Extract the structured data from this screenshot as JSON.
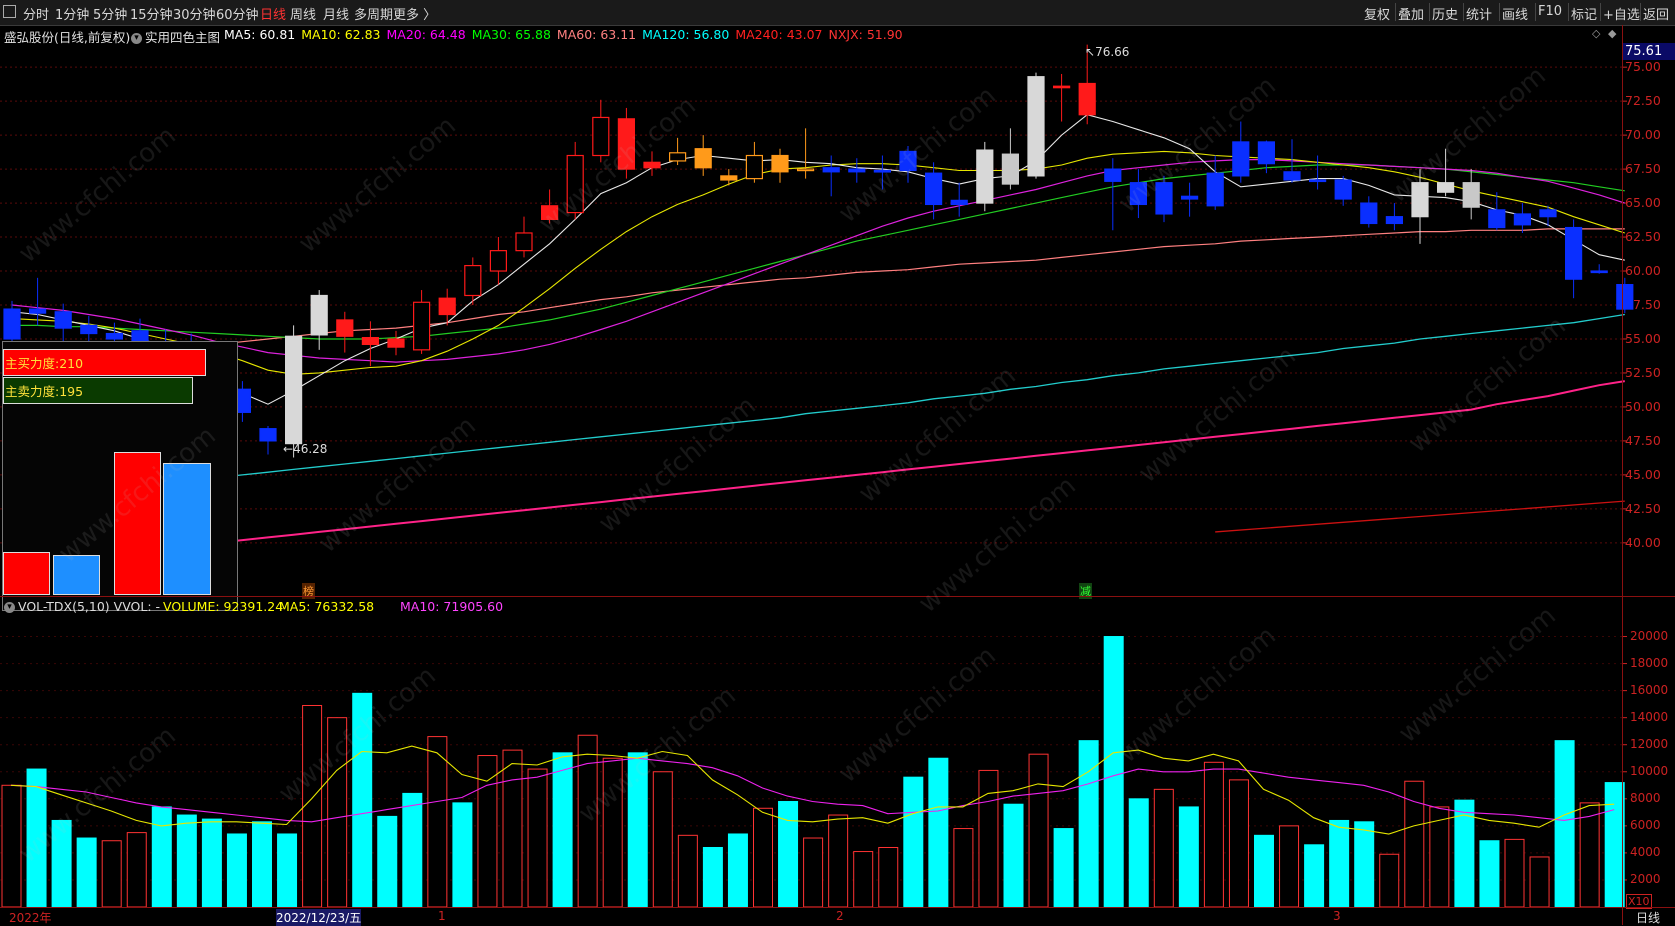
{
  "toolbar": {
    "collapse_icon": "collapse-icon",
    "periods": [
      "分时",
      "1分钟",
      "5分钟",
      "15分钟",
      "30分钟",
      "60分钟",
      "日线",
      "周线",
      "月线",
      "多周期",
      "更多 〉"
    ],
    "active_period": "日线",
    "right_buttons": [
      "复权",
      "叠加",
      "历史",
      "统计",
      "画线",
      "F10",
      "标记",
      "+自选",
      "返回"
    ]
  },
  "main_chart": {
    "stock_title": "盛弘股份(日线,前复权)",
    "indicator_name": "实用四色主图",
    "ma_labels": [
      {
        "text": "MA5: 60.81",
        "color": "#ffffff"
      },
      {
        "text": "MA10: 62.83",
        "color": "#ffff00"
      },
      {
        "text": "MA20: 64.48",
        "color": "#ff00ff"
      },
      {
        "text": "MA30: 65.88",
        "color": "#00ff00"
      },
      {
        "text": "MA60: 63.11",
        "color": "#ff8080"
      },
      {
        "text": "MA120: 56.80",
        "color": "#00ffff"
      },
      {
        "text": "MA240: 43.07",
        "color": "#ff2020"
      },
      {
        "text": "NXJX: 51.90",
        "color": "#ff3333"
      }
    ],
    "current_price": "75.61",
    "high_marker": "76.66",
    "low_marker": "46.28",
    "markers": [
      {
        "text": "榜",
        "color": "#ff9933"
      },
      {
        "text": "减",
        "color": "#33ff33"
      }
    ],
    "right_icons": [
      "diamond-outline-icon",
      "diamond-icon"
    ]
  },
  "price_axis": [
    "75.00",
    "72.50",
    "70.00",
    "67.50",
    "65.00",
    "62.50",
    "60.00",
    "57.50",
    "55.00",
    "52.50",
    "50.00",
    "47.50",
    "45.00",
    "42.50",
    "40.00"
  ],
  "panel": {
    "buy_label": "主买力度:210",
    "sell_label": "主卖力度:195",
    "buy_value": 210,
    "sell_value": 195,
    "bars": [
      {
        "color": "#ff0000",
        "value": 0.3
      },
      {
        "color": "#1e8fff",
        "value": 0.28
      },
      {
        "color": "#ff0000",
        "value": 1.0
      },
      {
        "color": "#1e8fff",
        "value": 0.92
      }
    ]
  },
  "vol_chart": {
    "title": "VOL-TDX(5,10)",
    "vvol": "VVOL: -",
    "volume_label": "VOLUME: 92391.24",
    "ma5_label": "MA5: 76332.58",
    "ma10_label": "MA10: 71905.60",
    "unit_label": "X10",
    "axis": [
      "20000",
      "18000",
      "16000",
      "14000",
      "12000",
      "10000",
      "8000",
      "6000",
      "4000",
      "2000"
    ]
  },
  "x_axis": {
    "labels": [
      "2022年",
      "2022/12/23/五",
      "1",
      "2",
      "3"
    ],
    "period_label": "日线"
  },
  "watermark": "www.cfchi.com",
  "chart_data": {
    "type": "candlestick",
    "y_range": [
      38,
      77
    ],
    "candles": [
      [
        55.0,
        57.2,
        54.8,
        57.8,
        "blue"
      ],
      [
        57.2,
        56.9,
        56.0,
        59.5,
        "blue"
      ],
      [
        57.0,
        55.8,
        54.6,
        57.6,
        "blue"
      ],
      [
        55.4,
        56.0,
        54.2,
        56.7,
        "blue"
      ],
      [
        55.0,
        55.4,
        53.2,
        56.2,
        "blue"
      ],
      [
        54.8,
        55.6,
        53.8,
        56.5,
        "blue"
      ],
      [
        54.6,
        54.8,
        52.4,
        55.7,
        "blue"
      ],
      [
        54.8,
        53.0,
        52.1,
        55.4,
        "blue"
      ],
      [
        52.8,
        51.2,
        50.5,
        53.3,
        "blue"
      ],
      [
        51.3,
        49.6,
        48.9,
        51.9,
        "blue"
      ],
      [
        48.4,
        47.5,
        46.5,
        48.6,
        "blue"
      ],
      [
        47.3,
        55.2,
        46.28,
        56.0,
        "white"
      ],
      [
        55.3,
        58.2,
        54.2,
        58.6,
        "white"
      ],
      [
        56.4,
        55.2,
        54.0,
        57.0,
        "red"
      ],
      [
        55.1,
        54.6,
        53.0,
        56.3,
        "red"
      ],
      [
        55.0,
        54.4,
        53.8,
        55.6,
        "red"
      ],
      [
        54.2,
        57.7,
        53.9,
        58.6,
        "redh"
      ],
      [
        56.8,
        58.0,
        56.0,
        58.7,
        "red"
      ],
      [
        58.2,
        60.4,
        57.5,
        61.0,
        "redh"
      ],
      [
        60.0,
        61.5,
        59.0,
        62.5,
        "redh"
      ],
      [
        61.5,
        62.8,
        61.0,
        64.0,
        "redh"
      ],
      [
        63.8,
        64.8,
        63.5,
        66.0,
        "red"
      ],
      [
        64.3,
        68.5,
        63.8,
        69.5,
        "redh"
      ],
      [
        68.5,
        71.3,
        68.0,
        72.6,
        "redh"
      ],
      [
        71.2,
        67.5,
        66.8,
        72.0,
        "red"
      ],
      [
        68.0,
        67.6,
        67.0,
        68.8,
        "red"
      ],
      [
        68.1,
        68.7,
        67.8,
        69.8,
        "orangeh"
      ],
      [
        69.0,
        67.6,
        67.0,
        70.0,
        "orange"
      ],
      [
        67.0,
        66.7,
        66.3,
        67.5,
        "orange"
      ],
      [
        66.8,
        68.5,
        66.5,
        69.5,
        "orangeh"
      ],
      [
        68.5,
        67.3,
        66.5,
        69.0,
        "orange"
      ],
      [
        67.5,
        67.5,
        66.8,
        70.5,
        "orangeh"
      ],
      [
        67.6,
        67.3,
        65.5,
        68.5,
        "blue"
      ],
      [
        67.5,
        67.3,
        66.5,
        68.3,
        "blue"
      ],
      [
        67.4,
        67.3,
        66.0,
        68.5,
        "blue"
      ],
      [
        68.8,
        67.4,
        66.5,
        69.2,
        "blue"
      ],
      [
        67.2,
        64.9,
        63.8,
        68.0,
        "blue"
      ],
      [
        64.9,
        65.2,
        64.0,
        66.5,
        "blue"
      ],
      [
        65.0,
        68.9,
        64.4,
        69.5,
        "white"
      ],
      [
        66.4,
        68.6,
        66.0,
        70.5,
        "gray"
      ],
      [
        67.0,
        74.3,
        66.8,
        74.6,
        "white"
      ],
      [
        73.6,
        73.6,
        71.0,
        74.5,
        "red"
      ],
      [
        73.8,
        71.5,
        70.8,
        76.66,
        "red"
      ],
      [
        67.5,
        66.6,
        63.0,
        68.3,
        "blue"
      ],
      [
        66.5,
        64.9,
        63.9,
        67.5,
        "blue"
      ],
      [
        66.5,
        64.2,
        63.6,
        67.0,
        "blue"
      ],
      [
        65.5,
        65.3,
        64.0,
        66.5,
        "blue"
      ],
      [
        67.2,
        64.8,
        64.5,
        68.5,
        "blue"
      ],
      [
        69.5,
        67.0,
        66.5,
        71.0,
        "blue"
      ],
      [
        69.5,
        67.9,
        67.2,
        69.6,
        "blue"
      ],
      [
        67.3,
        66.7,
        66.5,
        69.7,
        "blue"
      ],
      [
        66.7,
        66.7,
        66.0,
        68.5,
        "blue"
      ],
      [
        66.7,
        65.3,
        64.8,
        67.0,
        "blue"
      ],
      [
        65.0,
        63.5,
        63.2,
        65.5,
        "blue"
      ],
      [
        63.5,
        64.0,
        63.0,
        65.0,
        "blue"
      ],
      [
        64.0,
        66.5,
        62.0,
        67.5,
        "white"
      ],
      [
        65.8,
        66.5,
        65.5,
        69.0,
        "white"
      ],
      [
        66.5,
        64.7,
        63.8,
        67.5,
        "gray"
      ],
      [
        64.5,
        63.2,
        63.0,
        65.8,
        "blue"
      ],
      [
        64.2,
        63.4,
        62.8,
        65.0,
        "blue"
      ],
      [
        64.5,
        64.0,
        63.3,
        64.8,
        "blue"
      ],
      [
        63.2,
        59.4,
        58.0,
        63.8,
        "blue"
      ],
      [
        60.0,
        60.0,
        59.8,
        60.5,
        "blue"
      ],
      [
        59.0,
        57.2,
        56.9,
        59.5,
        "blue"
      ]
    ],
    "ma5": [
      57.0,
      56.8,
      56.4,
      56.0,
      55.6,
      55.0,
      54.5,
      53.6,
      52.4,
      51.0,
      50.2,
      51.2,
      52.3,
      53.4,
      54.3,
      55.0,
      55.8,
      56.2,
      57.8,
      59.0,
      60.5,
      62.0,
      63.8,
      65.7,
      66.5,
      67.6,
      68.2,
      68.5,
      68.3,
      68.1,
      68.2,
      68.0,
      67.9,
      67.6,
      67.5,
      67.3,
      66.8,
      66.4,
      66.8,
      67.0,
      68.1,
      70.0,
      71.5,
      71.0,
      70.4,
      69.8,
      69.0,
      67.3,
      66.2,
      66.4,
      66.6,
      66.8,
      66.8,
      66.3,
      65.6,
      65.5,
      65.4,
      65.1,
      64.5,
      64.1,
      63.4,
      62.3,
      61.2,
      60.8
    ],
    "ma10": [
      56.5,
      56.4,
      56.3,
      56.1,
      55.8,
      55.4,
      55.0,
      54.6,
      54.0,
      53.4,
      52.7,
      52.4,
      52.5,
      52.7,
      52.9,
      53.0,
      53.4,
      54.1,
      55.0,
      56.0,
      57.3,
      58.7,
      60.2,
      61.6,
      62.9,
      64.0,
      64.9,
      65.6,
      66.4,
      67.1,
      67.5,
      67.6,
      67.8,
      67.9,
      67.9,
      67.8,
      67.6,
      67.4,
      67.4,
      67.4,
      67.5,
      67.8,
      68.3,
      68.6,
      68.7,
      68.8,
      68.7,
      68.5,
      68.4,
      68.3,
      68.2,
      68.0,
      67.8,
      67.6,
      67.3,
      66.9,
      66.4,
      65.9,
      65.5,
      65.1,
      64.7,
      64.0,
      63.4,
      62.8
    ],
    "ma20": [
      57.5,
      57.3,
      57.1,
      56.8,
      56.5,
      56.1,
      55.7,
      55.3,
      54.8,
      54.4,
      54.0,
      53.8,
      53.6,
      53.5,
      53.4,
      53.3,
      53.4,
      53.5,
      53.7,
      53.9,
      54.2,
      54.6,
      55.1,
      55.7,
      56.3,
      57.0,
      57.7,
      58.4,
      59.1,
      59.8,
      60.5,
      61.2,
      61.9,
      62.6,
      63.3,
      63.9,
      64.4,
      64.8,
      65.2,
      65.6,
      66.0,
      66.5,
      67.0,
      67.4,
      67.6,
      67.8,
      68.0,
      68.1,
      68.2,
      68.2,
      68.1,
      68.0,
      67.9,
      67.8,
      67.7,
      67.6,
      67.5,
      67.4,
      67.2,
      66.9,
      66.6,
      66.1,
      65.6,
      65.0
    ],
    "ma30": [
      56.0,
      56.0,
      55.9,
      55.9,
      55.8,
      55.7,
      55.6,
      55.5,
      55.4,
      55.3,
      55.2,
      55.1,
      55.0,
      55.0,
      55.0,
      55.1,
      55.2,
      55.4,
      55.6,
      55.8,
      56.1,
      56.4,
      56.8,
      57.2,
      57.7,
      58.2,
      58.7,
      59.2,
      59.7,
      60.2,
      60.7,
      61.2,
      61.7,
      62.2,
      62.6,
      63.0,
      63.4,
      63.8,
      64.2,
      64.6,
      65.0,
      65.4,
      65.8,
      66.2,
      66.5,
      66.8,
      67.0,
      67.2,
      67.4,
      67.6,
      67.7,
      67.8,
      67.8,
      67.8,
      67.7,
      67.6,
      67.5,
      67.3,
      67.1,
      66.9,
      66.7,
      66.5,
      66.2,
      65.9
    ],
    "ma60": [
      53.0,
      53.2,
      53.4,
      53.6,
      53.8,
      54.0,
      54.2,
      54.4,
      54.6,
      54.8,
      55.0,
      55.2,
      55.4,
      55.6,
      55.7,
      55.8,
      56.0,
      56.2,
      56.5,
      56.8,
      57.0,
      57.3,
      57.6,
      57.9,
      58.1,
      58.4,
      58.6,
      58.8,
      59.0,
      59.2,
      59.4,
      59.5,
      59.7,
      59.9,
      60.0,
      60.1,
      60.3,
      60.5,
      60.6,
      60.7,
      60.8,
      61.0,
      61.2,
      61.4,
      61.6,
      61.8,
      61.9,
      62.0,
      62.2,
      62.3,
      62.4,
      62.5,
      62.6,
      62.7,
      62.8,
      62.9,
      62.9,
      63.0,
      63.0,
      63.0,
      63.1,
      63.1,
      63.1,
      63.1
    ],
    "ma120": [
      43.2,
      43.4,
      43.6,
      43.8,
      44.0,
      44.2,
      44.4,
      44.6,
      44.8,
      45.0,
      45.2,
      45.4,
      45.6,
      45.8,
      46.0,
      46.2,
      46.4,
      46.6,
      46.8,
      47.0,
      47.2,
      47.4,
      47.6,
      47.8,
      48.0,
      48.2,
      48.4,
      48.6,
      48.8,
      49.0,
      49.2,
      49.5,
      49.7,
      49.9,
      50.1,
      50.3,
      50.6,
      50.8,
      51.0,
      51.3,
      51.5,
      51.8,
      52.0,
      52.3,
      52.5,
      52.8,
      53.0,
      53.2,
      53.4,
      53.6,
      53.8,
      54.0,
      54.3,
      54.5,
      54.7,
      55.0,
      55.2,
      55.4,
      55.6,
      55.8,
      56.0,
      56.2,
      56.5,
      56.8
    ],
    "nxjx": [
      38.4,
      38.6,
      38.8,
      39.0,
      39.2,
      39.4,
      39.6,
      39.8,
      40.0,
      40.2,
      40.4,
      40.6,
      40.8,
      41.0,
      41.2,
      41.4,
      41.6,
      41.8,
      42.0,
      42.2,
      42.4,
      42.6,
      42.8,
      43.0,
      43.2,
      43.4,
      43.6,
      43.8,
      44.0,
      44.2,
      44.4,
      44.6,
      44.8,
      45.0,
      45.2,
      45.4,
      45.6,
      45.8,
      46.0,
      46.2,
      46.4,
      46.6,
      46.8,
      47.0,
      47.2,
      47.4,
      47.6,
      47.8,
      48.0,
      48.2,
      48.4,
      48.6,
      48.8,
      49.0,
      49.2,
      49.4,
      49.6,
      49.8,
      50.2,
      50.5,
      50.8,
      51.2,
      51.6,
      51.9
    ],
    "ma240": [
      [
        47,
        40.8
      ],
      [
        63,
        43.07
      ]
    ],
    "volume": {
      "y_range": [
        0,
        21000
      ],
      "values": [
        9000,
        10200,
        6400,
        5100,
        4900,
        5500,
        7400,
        6800,
        6500,
        5400,
        6300,
        5400,
        14900,
        14000,
        15800,
        6700,
        8400,
        12600,
        7700,
        11200,
        11600,
        10200,
        11400,
        12700,
        11000,
        11400,
        10000,
        5300,
        4400,
        5400,
        7300,
        7800,
        5100,
        6800,
        4100,
        4400,
        9600,
        11000,
        5800,
        10100,
        7600,
        11300,
        5800,
        12300,
        20000,
        8000,
        8700,
        7400,
        10700,
        9400,
        5300,
        6000,
        4600,
        6400,
        6300,
        3900,
        9300,
        7400,
        7900,
        4900,
        5000,
        3700,
        12300,
        7700,
        9200
      ],
      "hollow": [
        true,
        false,
        false,
        false,
        true,
        true,
        false,
        false,
        false,
        false,
        false,
        false,
        true,
        true,
        false,
        false,
        false,
        true,
        false,
        true,
        true,
        true,
        false,
        true,
        true,
        false,
        true,
        true,
        false,
        false,
        true,
        false,
        true,
        true,
        true,
        true,
        false,
        false,
        true,
        true,
        false,
        true,
        false,
        false,
        false,
        false,
        true,
        false,
        true,
        true,
        false,
        true,
        false,
        false,
        false,
        true,
        true,
        true,
        false,
        false,
        true,
        true,
        false,
        true,
        false
      ],
      "ma5": [
        9000,
        8900,
        8300,
        7700,
        7100,
        6400,
        6000,
        6200,
        6300,
        6300,
        6200,
        6100,
        8000,
        10100,
        11500,
        11400,
        11900,
        11400,
        9800,
        9300,
        10600,
        10500,
        11100,
        11300,
        11200,
        11000,
        11500,
        11200,
        9400,
        8300,
        7000,
        6400,
        6300,
        6500,
        6600,
        6200,
        6900,
        7400,
        7400,
        8400,
        8600,
        9100,
        8900,
        10000,
        11400,
        11600,
        11000,
        10800,
        11300,
        10800,
        8700,
        7900,
        6600,
        5900,
        5700,
        5400,
        6000,
        6400,
        6800,
        6400,
        6200,
        5900,
        6800,
        7500,
        7600
      ],
      "ma10": [
        9000,
        8900,
        8700,
        8500,
        8100,
        7700,
        7400,
        7200,
        7000,
        6800,
        6600,
        6400,
        6300,
        6600,
        6900,
        7200,
        7500,
        7800,
        8100,
        9000,
        9400,
        9600,
        10100,
        10600,
        10800,
        11000,
        10800,
        10600,
        10300,
        9700,
        8800,
        8200,
        7800,
        7600,
        7500,
        6900,
        7000,
        7100,
        7500,
        7800,
        8200,
        8400,
        8600,
        9100,
        9700,
        10200,
        10000,
        10000,
        10200,
        10200,
        9900,
        9600,
        9400,
        9200,
        9000,
        8500,
        7800,
        7300,
        7000,
        6900,
        6800,
        6600,
        6400,
        6700,
        7200
      ]
    }
  }
}
